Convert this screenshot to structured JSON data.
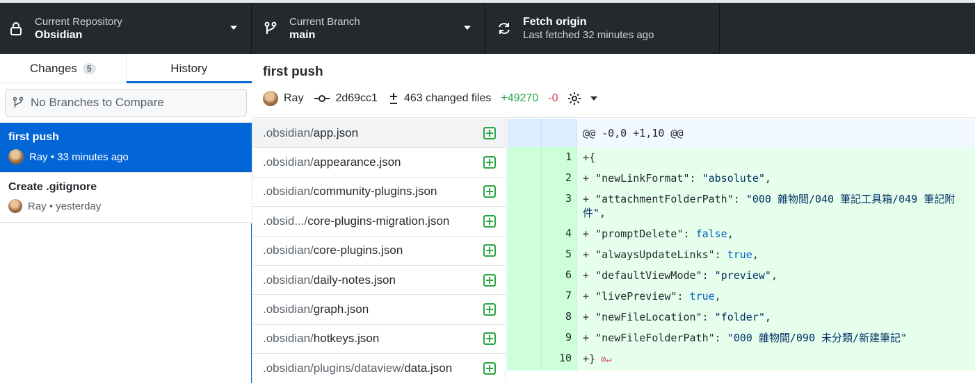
{
  "toolbar": {
    "repo": {
      "label": "Current Repository",
      "value": "Obsidian"
    },
    "branch": {
      "label": "Current Branch",
      "value": "main"
    },
    "fetch": {
      "label": "Fetch origin",
      "status": "Last fetched 32 minutes ago"
    }
  },
  "sidebar": {
    "tabs": [
      {
        "label": "Changes",
        "count": "5"
      },
      {
        "label": "History"
      }
    ],
    "compare_placeholder": "No Branches to Compare",
    "commits": [
      {
        "title": "first push",
        "author": "Ray",
        "time": "33 minutes ago"
      },
      {
        "title": "Create .gitignore",
        "author": "Ray",
        "time": "yesterday"
      }
    ]
  },
  "commit_header": {
    "title": "first push",
    "author": "Ray",
    "sha": "2d69cc1",
    "changed_files": "463 changed files",
    "additions": "+49270",
    "deletions": "-0"
  },
  "files": [
    {
      "dir": ".obsidian/",
      "name": "app.json"
    },
    {
      "dir": ".obsidian/",
      "name": "appearance.json"
    },
    {
      "dir": ".obsidian/",
      "name": "community-plugins.json"
    },
    {
      "dir": ".obsid.../",
      "name": "core-plugins-migration.json"
    },
    {
      "dir": ".obsidian/",
      "name": "core-plugins.json"
    },
    {
      "dir": ".obsidian/",
      "name": "daily-notes.json"
    },
    {
      "dir": ".obsidian/",
      "name": "graph.json"
    },
    {
      "dir": ".obsidian/",
      "name": "hotkeys.json"
    },
    {
      "dir": ".obsidian/plugins/dataview/",
      "name": "data.json"
    }
  ],
  "diff": {
    "hunk_header": "@@ -0,0 +1,10 @@",
    "lines": [
      {
        "num": "1",
        "prefix": "+",
        "key": "{",
        "sep": "",
        "value": "",
        "kind": ""
      },
      {
        "num": "2",
        "prefix": "+  ",
        "key": "\"newLinkFormat\"",
        "sep": ": ",
        "value": "\"absolute\"",
        "tail": ",",
        "kind": "str"
      },
      {
        "num": "3",
        "prefix": "+  ",
        "key": "\"attachmentFolderPath\"",
        "sep": ": ",
        "value": "\"000 雜物間/040 筆記工具箱/049 筆記附件\"",
        "tail": ",",
        "kind": "str"
      },
      {
        "num": "4",
        "prefix": "+  ",
        "key": "\"promptDelete\"",
        "sep": ": ",
        "value": "false",
        "tail": ",",
        "kind": "kw"
      },
      {
        "num": "5",
        "prefix": "+  ",
        "key": "\"alwaysUpdateLinks\"",
        "sep": ": ",
        "value": "true",
        "tail": ",",
        "kind": "kw"
      },
      {
        "num": "6",
        "prefix": "+  ",
        "key": "\"defaultViewMode\"",
        "sep": ": ",
        "value": "\"preview\"",
        "tail": ",",
        "kind": "str"
      },
      {
        "num": "7",
        "prefix": "+  ",
        "key": "\"livePreview\"",
        "sep": ": ",
        "value": "true",
        "tail": ",",
        "kind": "kw"
      },
      {
        "num": "8",
        "prefix": "+  ",
        "key": "\"newFileLocation\"",
        "sep": ": ",
        "value": "\"folder\"",
        "tail": ",",
        "kind": "str"
      },
      {
        "num": "9",
        "prefix": "+  ",
        "key": "\"newFileFolderPath\"",
        "sep": ": ",
        "value": "\"000 雜物間/090 未分類/新建筆記\"",
        "tail": "",
        "kind": "str"
      },
      {
        "num": "10",
        "prefix": "+",
        "key": "}",
        "sep": "",
        "value": "",
        "kind": ""
      }
    ]
  },
  "colors": {
    "toolbar_bg": "#24292e",
    "accent": "#0366d6",
    "added": "#28a745",
    "removed": "#d73a49"
  }
}
